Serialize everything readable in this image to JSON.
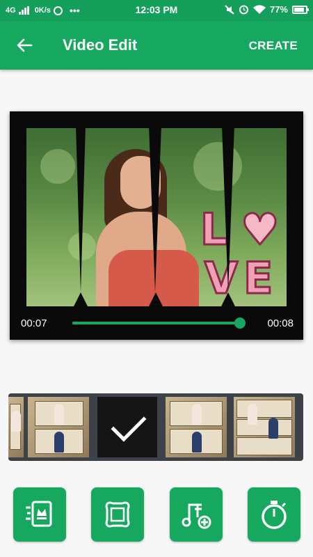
{
  "status_bar": {
    "network": "4G",
    "speed": "0K/s",
    "time": "12:03 PM",
    "battery": "77%",
    "icons": [
      "signal-icon",
      "whatsapp-icon",
      "more-icon",
      "mute-icon",
      "alarm-icon",
      "wifi-icon",
      "battery-icon"
    ]
  },
  "app_bar": {
    "title": "Video Edit",
    "create_label": "CREATE",
    "back_icon": "arrow-back-icon"
  },
  "player": {
    "current_time": "00:07",
    "total_time": "00:08",
    "progress": 0.98,
    "overlay_text": "LOVE"
  },
  "thumbnails": {
    "selected_index": 2,
    "count": 5,
    "selected_icon": "checkmark-icon"
  },
  "tools": [
    {
      "icon": "theme-crown-icon"
    },
    {
      "icon": "frame-icon"
    },
    {
      "icon": "add-music-icon"
    },
    {
      "icon": "duration-timer-icon"
    }
  ],
  "colors": {
    "accent": "#16a85e",
    "status_bar": "#14a05a",
    "strip_bg": "#3c4247",
    "background": "#f7f7f7"
  }
}
